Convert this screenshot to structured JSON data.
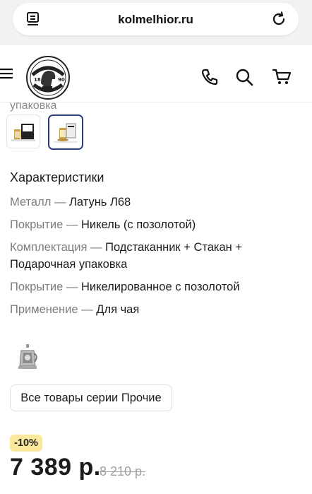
{
  "browser": {
    "url": "kolmelhior.ru"
  },
  "header": {
    "logo_alt": "Кольчугинский мельхиор"
  },
  "gallery": {
    "caption_fragment": "упаковка",
    "thumbnails": [
      "Подстаканник в подарочной коробке",
      "Подстаканник со стаканом и коробкой"
    ],
    "selected_index": 1
  },
  "characteristics": {
    "title": "Характеристики",
    "separator": "—",
    "items": [
      {
        "key": "Металл",
        "value": "Латунь Л68"
      },
      {
        "key": "Покрытие",
        "value": "Никель (с позолотой)"
      },
      {
        "key": "Комплектация",
        "value": "Подстаканник + Стакан + Подарочная упаковка"
      },
      {
        "key": "Покрытие",
        "value": "Никелированное с позолотой"
      },
      {
        "key": "Применение",
        "value": "Для чая"
      }
    ]
  },
  "series": {
    "button_label": "Все товары серии Прочие"
  },
  "pricing": {
    "discount": "-10%",
    "price": "7 389 р.",
    "old_price": "8 210 р."
  },
  "colors": {
    "accent_border": "#2d3d84",
    "badge_bg": "#fbe89a"
  }
}
